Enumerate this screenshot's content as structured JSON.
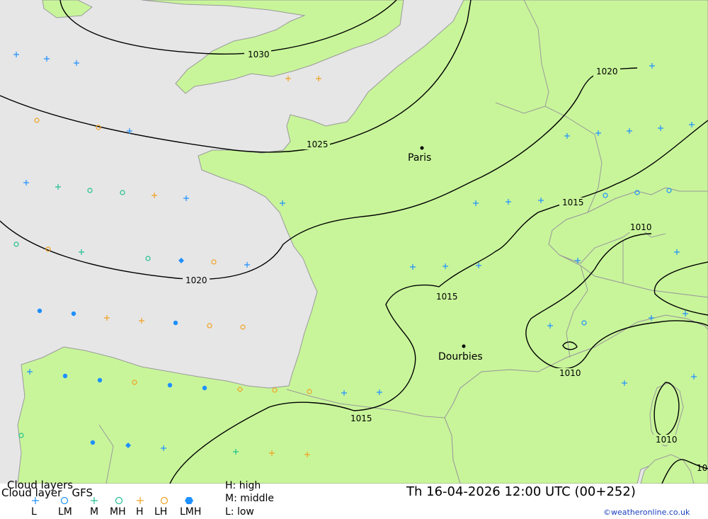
{
  "map": {
    "cities": [
      {
        "name": "Paris"
      },
      {
        "name": "Dourbies"
      }
    ],
    "isobar_labels": [
      "1030",
      "1025",
      "1020",
      "1020",
      "1015",
      "1015",
      "1015",
      "1010",
      "1010",
      "1010",
      "10"
    ]
  },
  "footer": {
    "title_line1": "Cloud layers",
    "title_line2": "Cloud layer   GFS",
    "legend_codes": [
      "L",
      "LM",
      "M",
      "MH",
      "H",
      "LH",
      "LMH"
    ],
    "level_high": "H: high",
    "level_middle": "M: middle",
    "level_low": "L: low",
    "datetime": "Th 16-04-2026 12:00 UTC (00+252)",
    "copyright": "©weatheronline.co.uk"
  },
  "colors": {
    "sea": "#e6e6e6",
    "land": "#c8f59a",
    "low": "#1e90ff",
    "middle": "#1fbf8f",
    "high": "#f0a020"
  }
}
